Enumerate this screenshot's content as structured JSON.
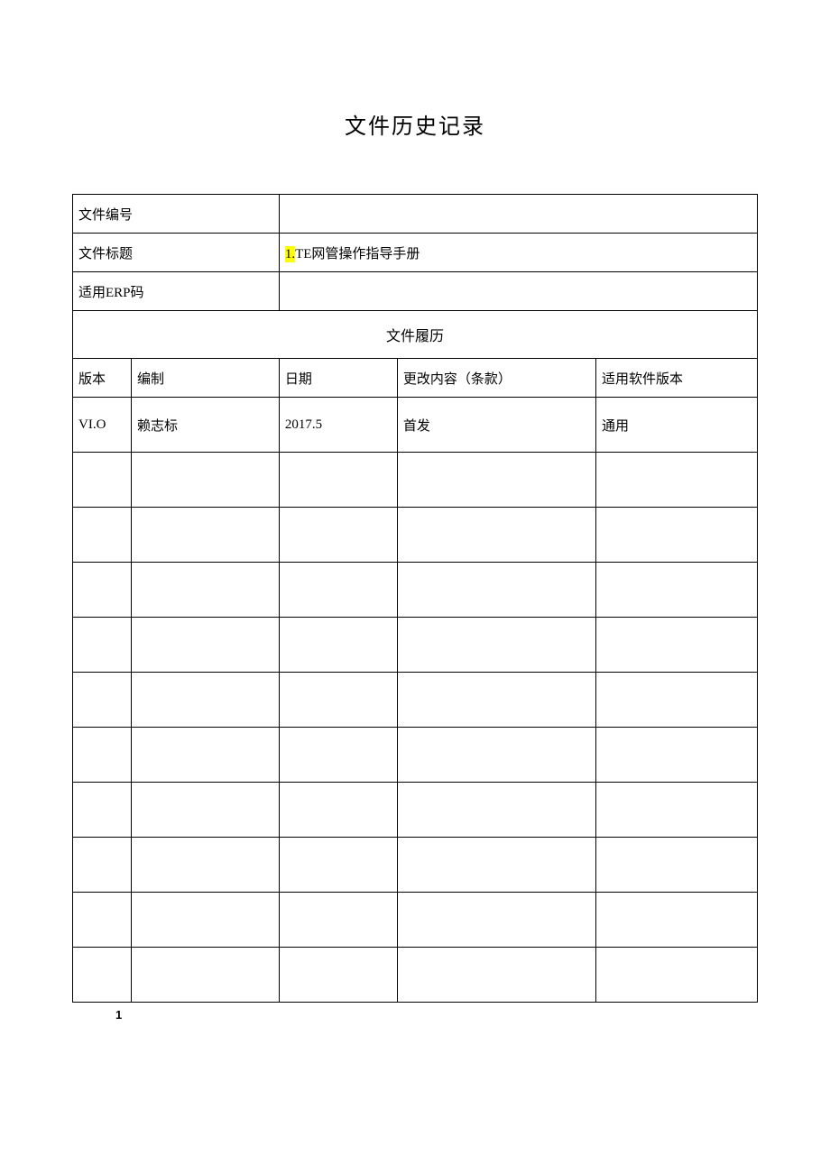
{
  "title": "文件历史记录",
  "meta": {
    "file_number_label": "文件编号",
    "file_number_value": "",
    "file_title_label": "文件标题",
    "file_title_prefix": "1.",
    "file_title_value": "TE网管操作指导手册",
    "erp_label": "适用ERP码",
    "erp_value": ""
  },
  "history_section_label": "文件履历",
  "history_headers": {
    "version": "版本",
    "author": "编制",
    "date": "日期",
    "change": "更改内容（条款）",
    "software": "适用软件版本"
  },
  "history_rows": [
    {
      "version": "VI.O",
      "author": "赖志标",
      "date": "2017.5",
      "change": "首发",
      "software": "通用"
    },
    {
      "version": "",
      "author": "",
      "date": "",
      "change": "",
      "software": ""
    },
    {
      "version": "",
      "author": "",
      "date": "",
      "change": "",
      "software": ""
    },
    {
      "version": "",
      "author": "",
      "date": "",
      "change": "",
      "software": ""
    },
    {
      "version": "",
      "author": "",
      "date": "",
      "change": "",
      "software": ""
    },
    {
      "version": "",
      "author": "",
      "date": "",
      "change": "",
      "software": ""
    },
    {
      "version": "",
      "author": "",
      "date": "",
      "change": "",
      "software": ""
    },
    {
      "version": "",
      "author": "",
      "date": "",
      "change": "",
      "software": ""
    },
    {
      "version": "",
      "author": "",
      "date": "",
      "change": "",
      "software": ""
    },
    {
      "version": "",
      "author": "",
      "date": "",
      "change": "",
      "software": ""
    },
    {
      "version": "",
      "author": "",
      "date": "",
      "change": "",
      "software": ""
    }
  ],
  "footer": "1"
}
